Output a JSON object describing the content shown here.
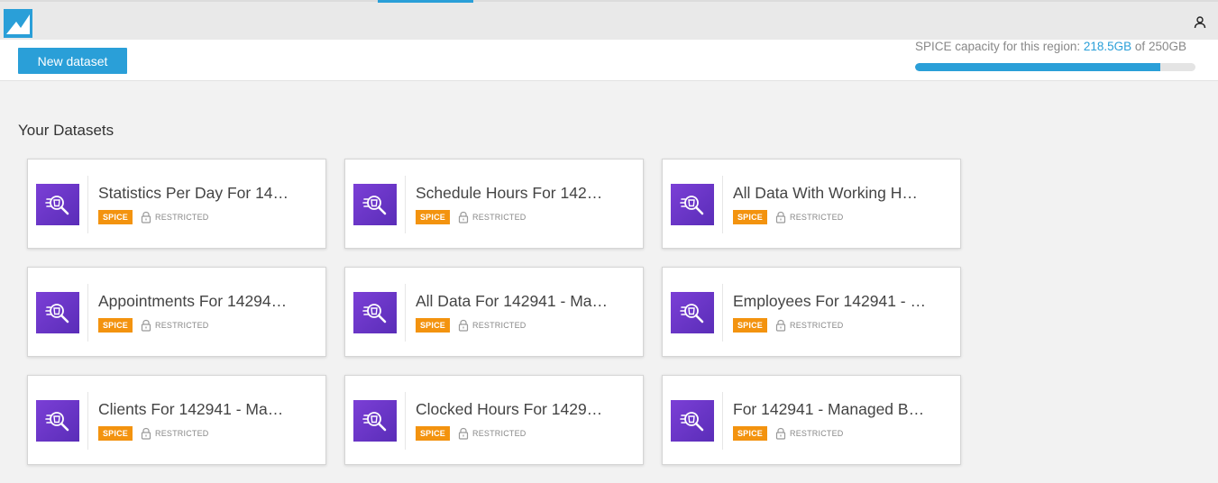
{
  "header": {
    "logo_icon": "quicksight-logo-icon",
    "user_icon": "user-icon"
  },
  "toolbar": {
    "new_dataset_label": "New dataset",
    "spice": {
      "label": "SPICE capacity for this region:",
      "used": "218.5GB",
      "of": "of",
      "total": "250GB",
      "used_fraction": 0.874
    }
  },
  "section": {
    "title": "Your Datasets"
  },
  "datasets": [
    {
      "title": "Statistics Per Day For 14…",
      "badge": "SPICE",
      "access": "RESTRICTED"
    },
    {
      "title": "Schedule Hours For 142…",
      "badge": "SPICE",
      "access": "RESTRICTED"
    },
    {
      "title": "All Data With Working H…",
      "badge": "SPICE",
      "access": "RESTRICTED"
    },
    {
      "title": "Appointments For 14294…",
      "badge": "SPICE",
      "access": "RESTRICTED"
    },
    {
      "title": "All Data For 142941 - Ma…",
      "badge": "SPICE",
      "access": "RESTRICTED"
    },
    {
      "title": "Employees For 142941 - …",
      "badge": "SPICE",
      "access": "RESTRICTED"
    },
    {
      "title": "Clients For 142941 - Ma…",
      "badge": "SPICE",
      "access": "RESTRICTED"
    },
    {
      "title": "Clocked Hours For 1429…",
      "badge": "SPICE",
      "access": "RESTRICTED"
    },
    {
      "title": "For 142941 - Managed B…",
      "badge": "SPICE",
      "access": "RESTRICTED"
    }
  ],
  "colors": {
    "accent": "#2a9fd8",
    "dataset_icon": "#6a34c8",
    "spice_badge": "#f3930f"
  }
}
